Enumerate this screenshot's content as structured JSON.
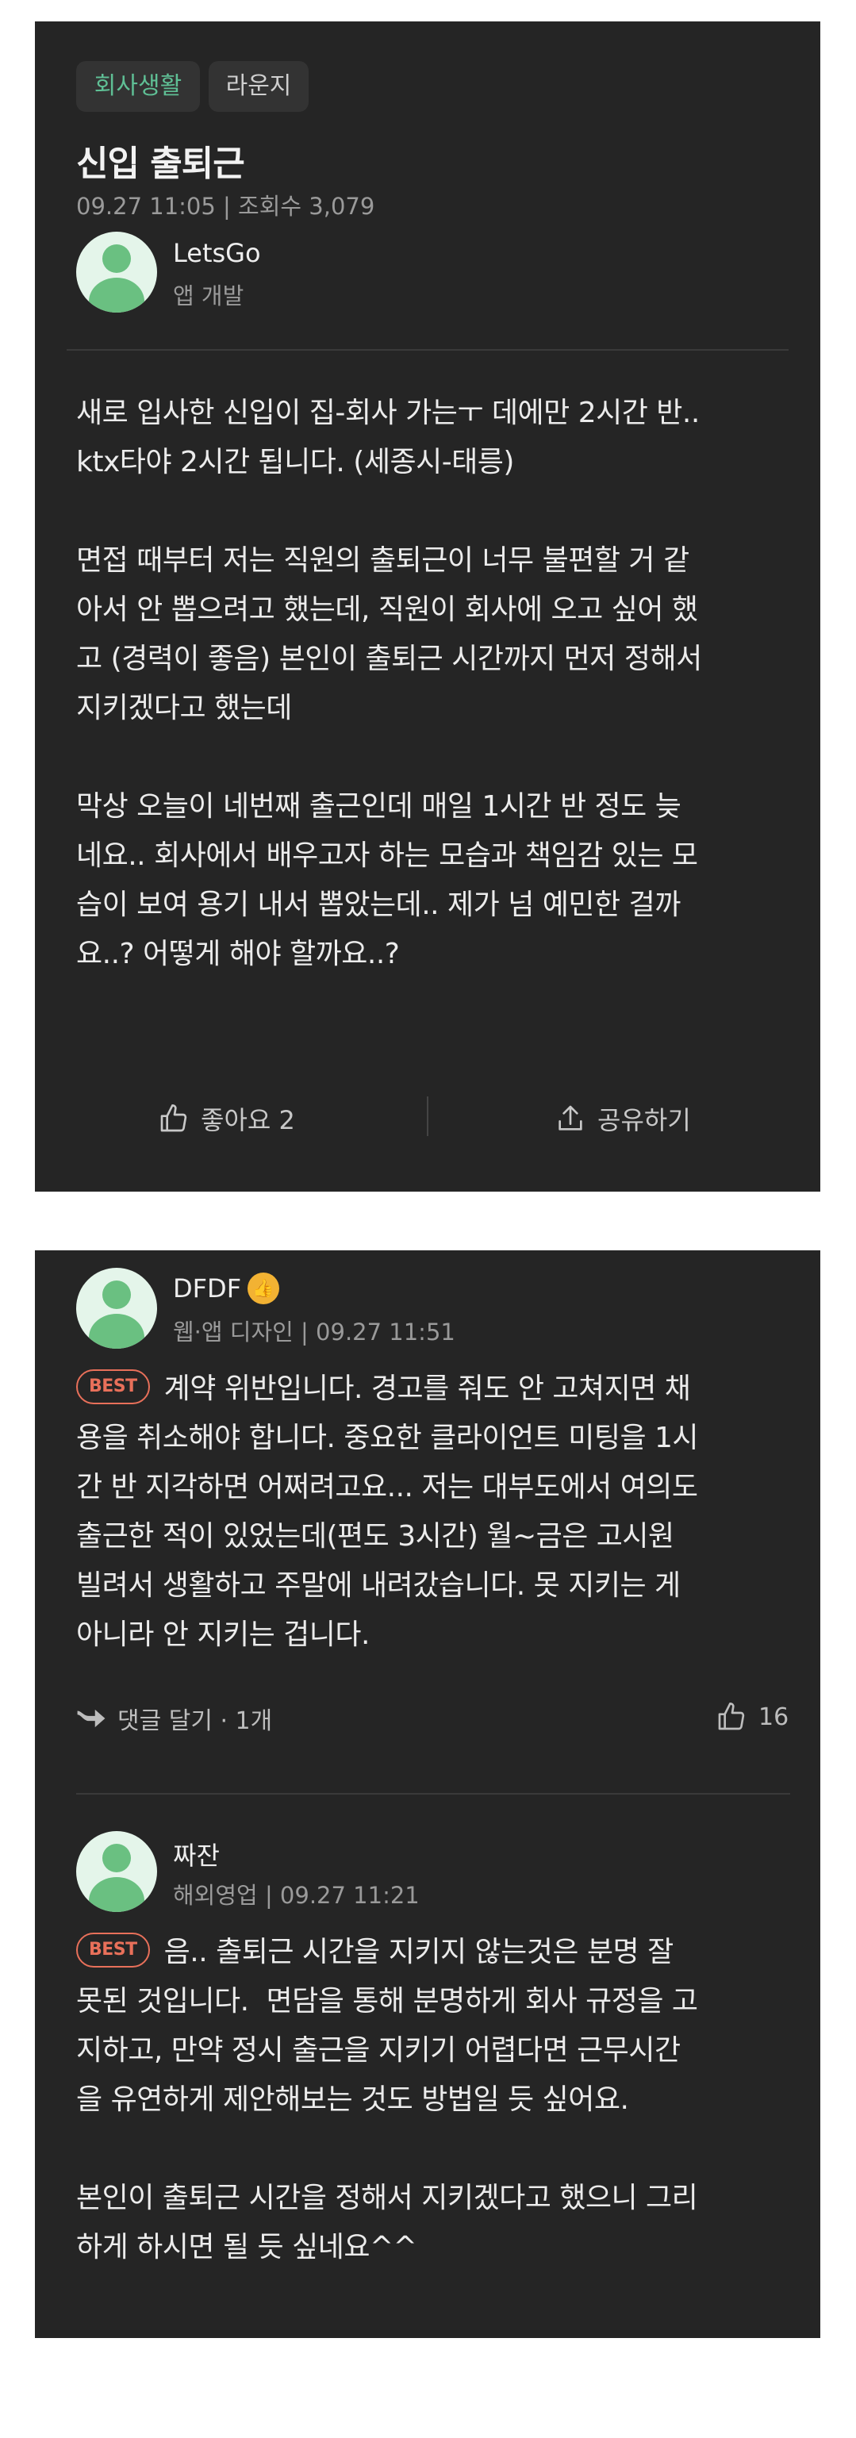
{
  "post": {
    "category": "회사생활",
    "board": "라운지",
    "title": "신입 출퇴근",
    "meta": "09.27 11:05 | 조회수 3,079",
    "author": {
      "name": "LetsGo",
      "dept": "앱 개발"
    },
    "body": "새로 입사한 신입이 집-회사 가는ㅜ 데에만 2시간 반..\nktx타야 2시간 됩니다. (세종시-태릉)\n\n면접 때부터 저는 직원의 출퇴근이 너무 불편할 거 같\n아서 안 뽑으려고 했는데, 직원이 회사에 오고 싶어 했\n고 (경력이 좋음) 본인이 출퇴근 시간까지 먼저 정해서\n지키겠다고 했는데\n\n막상 오늘이 네번째 출근인데 매일 1시간 반 정도 늦\n네요.. 회사에서 배우고자 하는 모습과 책임감 있는 모\n습이 보여 용기 내서 뽑았는데.. 제가 넘 예민한 걸까\n요..? 어떻게 해야 할까요..?",
    "like_label": "좋아요 2",
    "share_label": "공유하기"
  },
  "comments": [
    {
      "author": "DFDF",
      "meta": "웹·앱 디자인 | 09.27 11:51",
      "best": "BEST",
      "body": "계약 위반입니다. 경고를 줘도 안 고쳐지면 채\n용을 취소해야 합니다. 중요한 클라이언트 미팅을 1시\n간 반 지각하면 어쩌려고요... 저는 대부도에서 여의도\n출근한 적이 있었는데(편도 3시간) 월~금은 고시원\n빌려서 생활하고 주말에 내려갔습니다. 못 지키는 게\n아니라 안 지키는 겁니다.",
      "reply_label": "댓글 달기 · 1개",
      "likes": "16"
    },
    {
      "author": "짜잔",
      "meta": "해외영업 | 09.27 11:21",
      "best": "BEST",
      "body": "음.. 출퇴근 시간을 지키지 않는것은 분명 잘\n못된 것입니다.  면담을 통해 분명하게 회사 규정을 고\n지하고, 만약 정시 출근을 지키기 어렵다면 근무시간\n을 유연하게 제안해보는 것도 방법일 듯 싶어요.\n\n본인이 출퇴근 시간을 정해서 지키겠다고 했으니 그리\n하게 하시면 될 듯 싶네요^^"
    }
  ]
}
